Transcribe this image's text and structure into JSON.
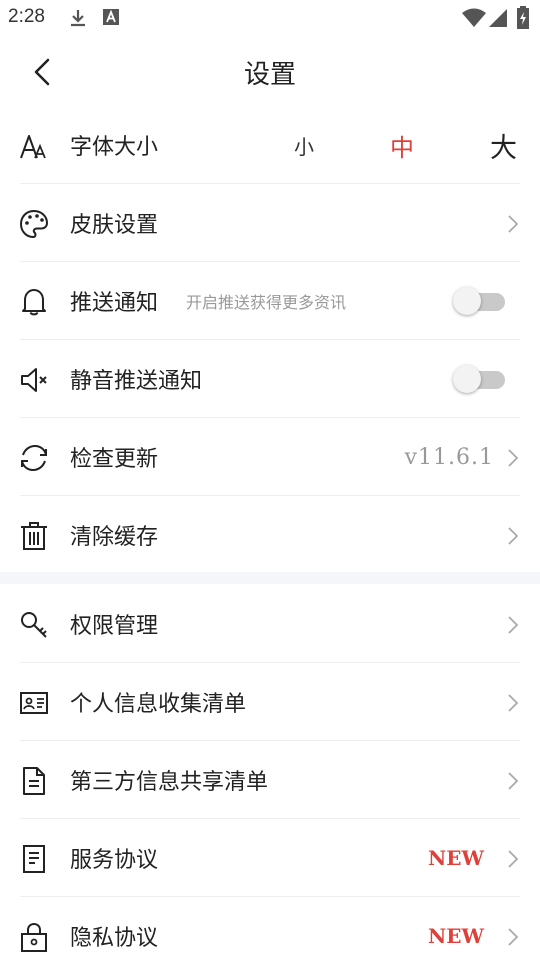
{
  "status_bar": {
    "time": "2:28",
    "icons": [
      "download-icon",
      "a-box-icon",
      "wifi-icon",
      "signal-icon",
      "battery-icon"
    ]
  },
  "header": {
    "title": "设置",
    "back_icon": "back-arrow-icon"
  },
  "font_size": {
    "label": "字体大小",
    "icon": "font-size-icon",
    "options": [
      "小",
      "中",
      "大"
    ],
    "selected": "中",
    "selected_color": "#e0403a"
  },
  "items": {
    "skin": {
      "label": "皮肤设置",
      "icon": "palette-icon"
    },
    "push": {
      "label": "推送通知",
      "subtitle": "开启推送获得更多资讯",
      "icon": "bell-icon",
      "enabled": false
    },
    "mute_push": {
      "label": "静音推送通知",
      "icon": "mute-icon",
      "enabled": false
    },
    "update": {
      "label": "检查更新",
      "icon": "refresh-icon",
      "version": "v11.6.1"
    },
    "cache": {
      "label": "清除缓存",
      "icon": "trash-icon"
    },
    "permission": {
      "label": "权限管理",
      "icon": "key-icon"
    },
    "personal_info": {
      "label": "个人信息收集清单",
      "icon": "id-card-icon"
    },
    "third_party": {
      "label": "第三方信息共享清单",
      "icon": "document-icon"
    },
    "service": {
      "label": "服务协议",
      "icon": "document-lines-icon",
      "badge": "NEW"
    },
    "privacy": {
      "label": "隐私协议",
      "icon": "lock-icon",
      "badge": "NEW"
    }
  },
  "colors": {
    "accent": "#e0403a",
    "divider": "#efefef",
    "section_background": "#f4f6f9"
  }
}
